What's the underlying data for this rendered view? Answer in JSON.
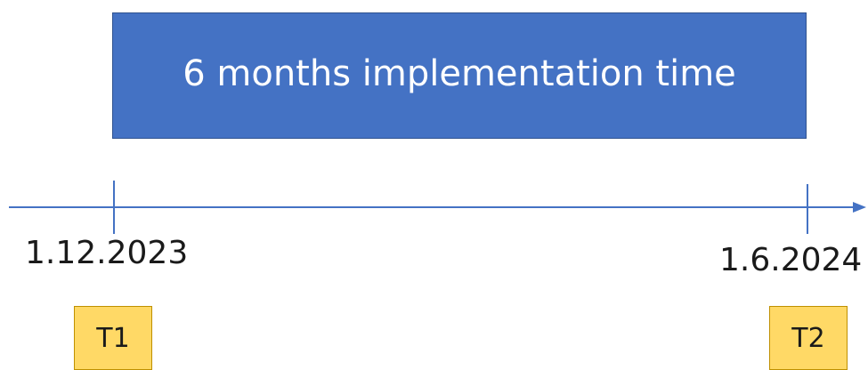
{
  "banner": {
    "text": "6 months implementation time",
    "fill_color": "#4472c4"
  },
  "timeline": {
    "line_color": "#4472c4",
    "start": {
      "date": "1.12.2023",
      "marker": "T1"
    },
    "end": {
      "date": "1.6.2024",
      "marker": "T2"
    },
    "marker_fill_color": "#ffd966"
  }
}
